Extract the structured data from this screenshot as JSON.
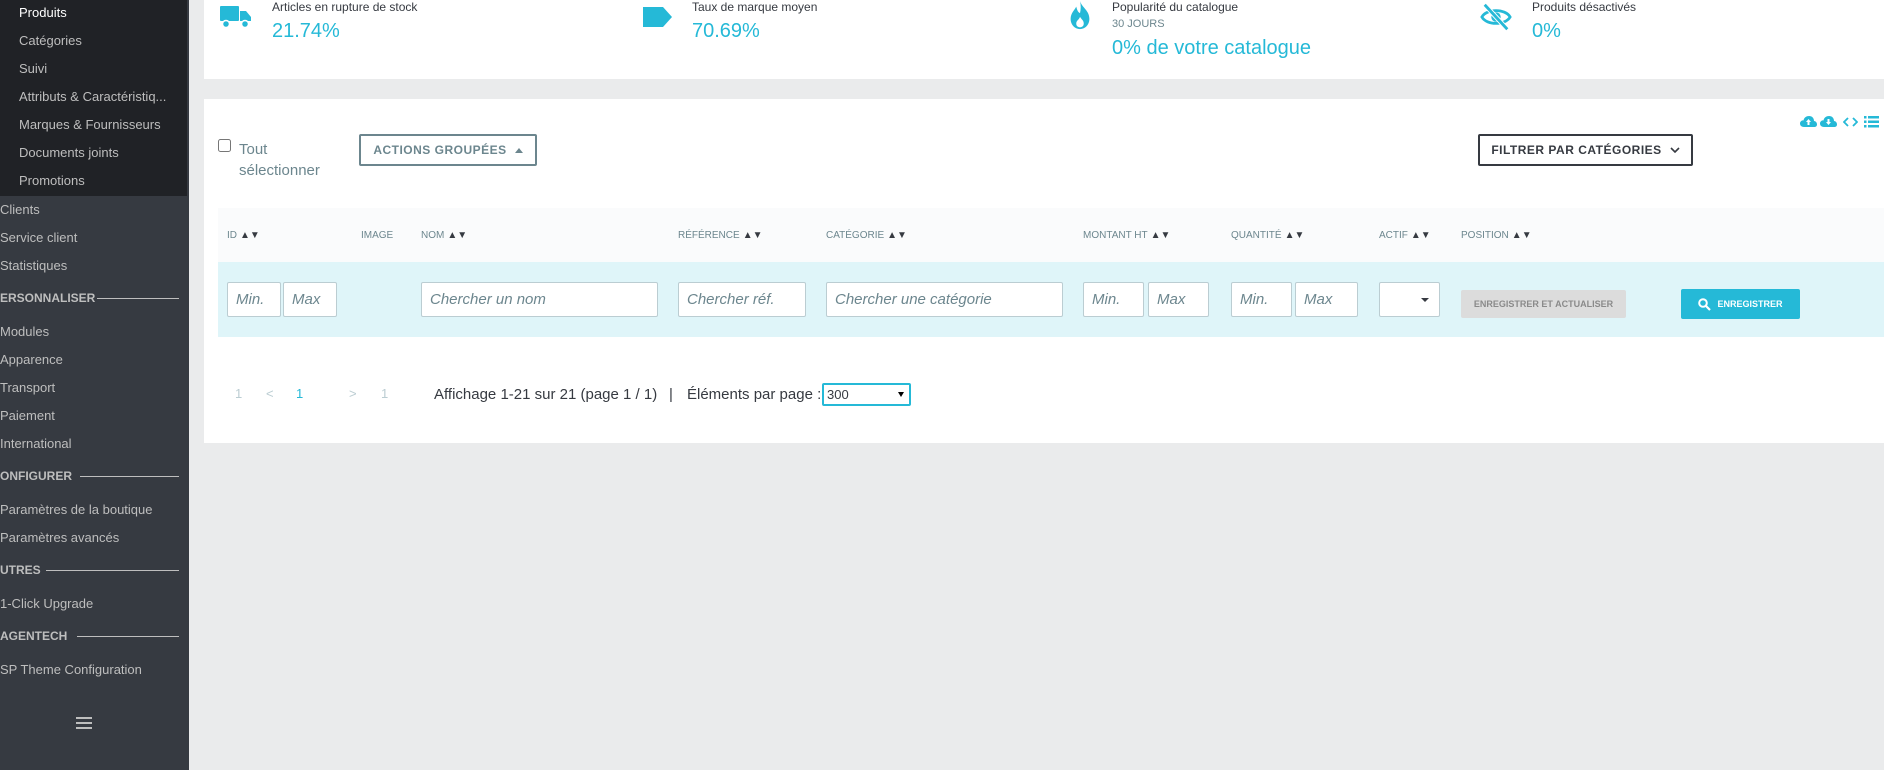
{
  "sidebar": {
    "submenu": [
      {
        "label": "Produits",
        "active": true
      },
      {
        "label": "Catégories"
      },
      {
        "label": "Suivi"
      },
      {
        "label": "Attributs & Caractéristiq..."
      },
      {
        "label": "Marques & Fournisseurs"
      },
      {
        "label": "Documents joints"
      },
      {
        "label": "Promotions"
      }
    ],
    "items": [
      {
        "label": "Clients"
      },
      {
        "label": "Service client"
      },
      {
        "label": "Statistiques"
      }
    ],
    "sections": [
      {
        "title": "ERSONNALISER",
        "items": [
          "Modules",
          "Apparence",
          "Transport",
          "Paiement",
          "International"
        ]
      },
      {
        "title": "ONFIGURER",
        "items": [
          "Paramètres de la boutique",
          "Paramètres avancés"
        ]
      },
      {
        "title": "UTRES",
        "items": [
          "1-Click Upgrade"
        ]
      },
      {
        "title": "AGENTECH",
        "items": [
          "SP Theme Configuration"
        ]
      }
    ]
  },
  "kpis": [
    {
      "label": "Articles en rupture de stock",
      "value": "21.74%",
      "icon": "truck-icon"
    },
    {
      "label": "Taux de marque moyen",
      "value": "70.69%",
      "icon": "tag-icon"
    },
    {
      "label": "Popularité du catalogue",
      "sub": "30 JOURS",
      "value": "0% de votre catalogue",
      "icon": "flame-icon"
    },
    {
      "label": "Produits désactivés",
      "value": "0%",
      "icon": "eye-off-icon"
    }
  ],
  "toolbar": {
    "select_all": "Tout sélectionner",
    "bulk_actions": "ACTIONS GROUPÉES",
    "filter_categories": "FILTRER PAR CATÉGORIES",
    "icons": [
      "cloud-upload-icon",
      "cloud-download-icon",
      "code-icon",
      "list-icon"
    ]
  },
  "table": {
    "headers": {
      "id": "ID",
      "image": "IMAGE",
      "name": "NOM",
      "reference": "RÉFÉRENCE",
      "category": "CATÉGORIE",
      "price": "MONTANT HT",
      "quantity": "QUANTITÉ",
      "active": "ACTIF",
      "position": "POSITION"
    },
    "sort_glyph": "▲▼",
    "filters": {
      "min": "Min.",
      "max": "Max",
      "name": "Chercher un nom",
      "reference": "Chercher réf.",
      "category": "Chercher une catégorie"
    },
    "save_refresh": "ENREGISTRER ET ACTUALISER",
    "save": "ENREGISTRER"
  },
  "pagination": {
    "first": "1",
    "prev": "<",
    "current": "1",
    "next": ">",
    "last": "1",
    "info": "Affichage 1-21 sur 21 (page 1 / 1)",
    "separator": "|",
    "per_page_label": "Éléments par page :",
    "per_page_value": "300"
  },
  "colors": {
    "accent": "#25b9d7",
    "sidebar": "#363a41",
    "submenu": "#202226"
  }
}
